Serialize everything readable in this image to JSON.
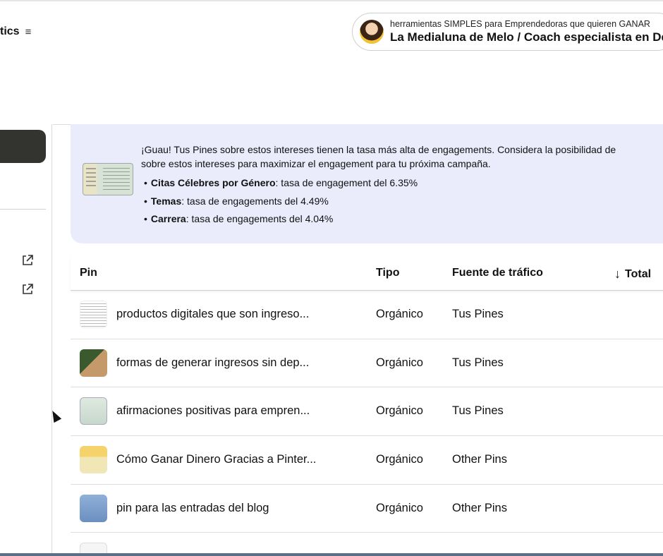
{
  "header": {
    "title_fragment": "tics",
    "menu_icon": "hamburger-icon"
  },
  "account": {
    "subtitle": "herramientas SIMPLES para Emprendedoras que quieren GANAR",
    "name": "La Medialuna de Melo / Coach especialista en De"
  },
  "sidebar": {
    "external_link_icons": [
      "external-link-icon",
      "external-link-icon"
    ]
  },
  "insight": {
    "intro_line1": "¡Guau! Tus Pines sobre estos intereses tienen la tasa más alta de engagements. Considera la posibilidad de",
    "intro_line2": "sobre estos intereses para maximizar el engagement para tu próxima campaña.",
    "items": [
      {
        "label": "Citas Célebres por Género",
        "rest": ": tasa de engagement del 6.35%"
      },
      {
        "label": "Temas",
        "rest": ": tasa de engagements del 4.49%"
      },
      {
        "label": "Carrera",
        "rest": ": tasa de engagements del 4.04%"
      }
    ]
  },
  "table": {
    "columns": {
      "pin": "Pin",
      "tipo": "Tipo",
      "fuente": "Fuente de tráfico",
      "total": "Total"
    },
    "rows": [
      {
        "title": "productos digitales que son ingreso...",
        "tipo": "Orgánico",
        "fuente": "Tus Pines"
      },
      {
        "title": "formas de generar ingresos sin dep...",
        "tipo": "Orgánico",
        "fuente": "Tus Pines"
      },
      {
        "title": "afirmaciones positivas para empren...",
        "tipo": "Orgánico",
        "fuente": "Tus Pines"
      },
      {
        "title": "Cómo Ganar Dinero Gracias a Pinter...",
        "tipo": "Orgánico",
        "fuente": "Other Pins"
      },
      {
        "title": "pin para las entradas del blog",
        "tipo": "Orgánico",
        "fuente": "Other Pins"
      }
    ]
  }
}
